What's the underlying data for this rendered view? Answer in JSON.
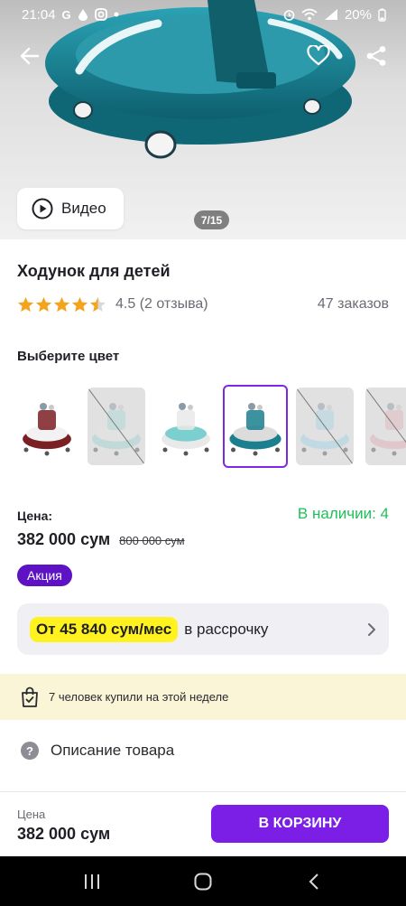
{
  "status_bar": {
    "time": "21:04",
    "left_icons": [
      "google-icon",
      "drop-icon",
      "instagram-icon",
      "dot-icon"
    ],
    "right_icons": [
      "alarm-icon",
      "wifi-icon",
      "signal-icon",
      "battery-icon"
    ],
    "battery": "20%"
  },
  "header": {
    "back_icon": "arrow-left-icon",
    "favorite_icon": "heart-icon",
    "share_icon": "share-icon"
  },
  "gallery": {
    "video_label": "Видео",
    "counter": "7/15"
  },
  "product": {
    "title": "Ходунок для детей",
    "rating_value": 4.5,
    "rating_text": "4.5 (2 отзыва)",
    "orders": "47 заказов"
  },
  "colors": {
    "heading": "Выберите цвет",
    "options": [
      {
        "name": "burgundy",
        "available": true,
        "selected": false,
        "frame": "#7a1f24",
        "tray": "#f2f2f2"
      },
      {
        "name": "mint-pink",
        "available": false,
        "selected": false,
        "frame": "#9fd8d4",
        "tray": "#e8e8e8"
      },
      {
        "name": "teal-light",
        "available": true,
        "selected": false,
        "frame": "#e9e9e9",
        "tray": "#7bd0cf"
      },
      {
        "name": "teal",
        "available": true,
        "selected": true,
        "frame": "#1b7f8f",
        "tray": "#dcdcdc"
      },
      {
        "name": "sky-blue",
        "available": false,
        "selected": false,
        "frame": "#9fd4e8",
        "tray": "#e6e6e6"
      },
      {
        "name": "pink",
        "available": false,
        "selected": false,
        "frame": "#e4aeb6",
        "tray": "#e6e6e6"
      }
    ]
  },
  "pricing": {
    "label": "Цена:",
    "stock": "В наличии: 4",
    "price": "382 000 сум",
    "old_price": "800 000 сум",
    "promo": "Акция"
  },
  "installment": {
    "highlight": "От 45 840 сум/мес",
    "text": "в рассрочку"
  },
  "buyers_banner": {
    "text": "7 человек купили на этой неделе"
  },
  "description": {
    "label": "Описание товара"
  },
  "bottom_bar": {
    "price_label": "Цена",
    "price": "382 000 сум",
    "cart_button": "В КОРЗИНУ"
  },
  "theme": {
    "accent": "#7b1fe6",
    "promo": "#5d12c4",
    "stock_green": "#1fbf5a",
    "highlight_yellow": "#fff21f",
    "star": "#f4a31b"
  }
}
